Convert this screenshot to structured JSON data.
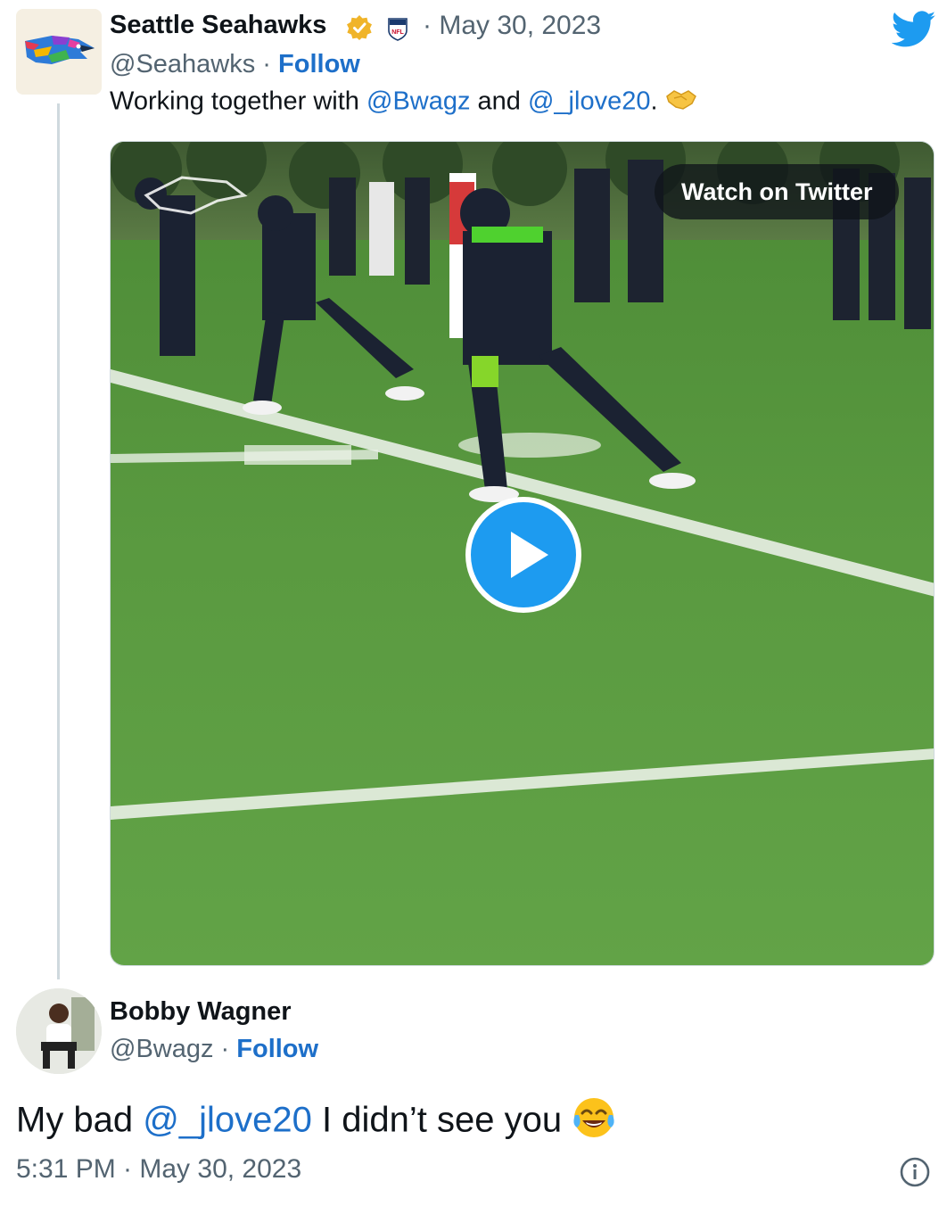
{
  "colors": {
    "link": "#1d6fc9",
    "muted": "#536471",
    "verified_badge": "#f0b429",
    "twitter_blue": "#1d9bf0",
    "thread_line": "#cfd9de"
  },
  "icons": {
    "twitter_logo": "twitter-bird-icon",
    "verified": "verified-badge-icon",
    "affiliate": "nfl-shield-icon",
    "play": "play-icon",
    "info": "info-icon",
    "handshake_emoji": "handshake-emoji",
    "laughing_emoji": "tears-of-joy-emoji"
  },
  "tweet1": {
    "author_name": "Seattle Seahawks",
    "date": "· May 30, 2023",
    "handle": "@Seahawks",
    "separator": " · ",
    "follow_label": "Follow",
    "text_prefix": "Working together with ",
    "mention1": "@Bwagz",
    "text_middle": " and ",
    "mention2": "@_jlove20",
    "text_suffix": ". ",
    "video": {
      "watch_label": "Watch on Twitter"
    }
  },
  "tweet2": {
    "author_name": "Bobby Wagner",
    "handle": "@Bwagz",
    "separator": " · ",
    "follow_label": "Follow",
    "text_prefix": "My bad ",
    "mention": "@_jlove20",
    "text_suffix": " I didn’t see you ",
    "timestamp": "5:31 PM · May 30, 2023"
  }
}
